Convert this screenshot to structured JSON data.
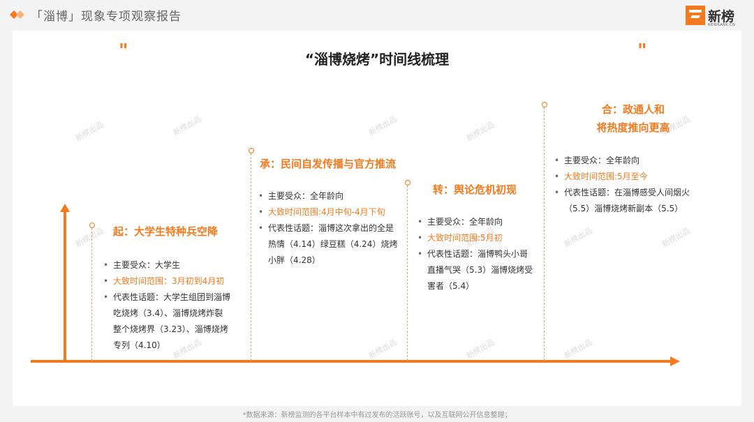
{
  "header": {
    "title": "「淄博」现象专项观察报告"
  },
  "logo": {
    "name": "新榜",
    "sub": "NEWRANK.CN"
  },
  "main": {
    "title": "“淄博烧烤”时间线梳理",
    "quote_left": "\"",
    "quote_right": "\""
  },
  "watermark": "新榜出品",
  "stages": [
    {
      "title": "起：大学生特种兵空降",
      "audience": "主要受众：大学生",
      "time": "大致时间范围：3月初到4月初",
      "topics_line1": "代表性话题：大学生组团到淄博",
      "topics_line2": "吃烧烤（3.4）、淄博烧烤炸裂",
      "topics_line3": "整个烧烤界（3.23）、淄博烧烤",
      "topics_line4": "专列（4.10）"
    },
    {
      "title": "承：民间自发传播与官方推流",
      "audience": "主要受众：全年龄向",
      "time": "大致时间范围:4月中旬-4月下旬",
      "topics_line1": "代表性话题：淄博这次拿出的全是",
      "topics_line2": "热情（4.14）绿豆糕（4.24）烧烤",
      "topics_line3": "小胖（4.28）"
    },
    {
      "title": "转：舆论危机初现",
      "audience": "主要受众：全年龄向",
      "time": "大致时间范围:5月初",
      "topics_line1": "代表性话题：淄博鸭头小哥",
      "topics_line2": "直播气哭（5.3）淄博烧烤受",
      "topics_line3": "害者（5.4）"
    },
    {
      "title_line1": "合：政通人和",
      "title_line2": "将热度推向更高",
      "audience": "主要受众：全年龄向",
      "time": "大致时间范围:5月至今",
      "topics_line1": "代表性话题：在淄博感受人间烟火",
      "topics_line2": "（5.5）淄博烧烤新副本（5.5）"
    }
  ],
  "footer": "*数据来源：新榜监测的各平台样本中有过发布的活跃账号，以及互联网公开信息整理；",
  "colors": {
    "accent": "#f47a1f",
    "text": "#333333",
    "background": "#f3f3f3"
  }
}
